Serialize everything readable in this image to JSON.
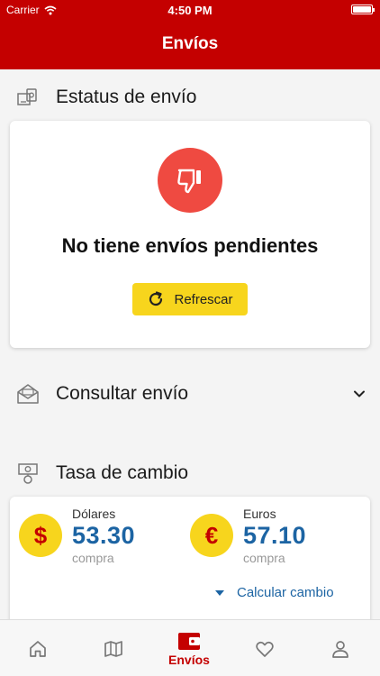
{
  "status_bar": {
    "carrier": "Carrier",
    "time": "4:50 PM"
  },
  "header": {
    "title": "Envíos"
  },
  "shipment_status": {
    "title": "Estatus de envío",
    "empty_message": "No tiene envíos pendientes",
    "refresh_label": "Refrescar"
  },
  "consult": {
    "title": "Consultar envío"
  },
  "exchange": {
    "title": "Tasa de cambio",
    "dollars": {
      "symbol": "$",
      "name": "Dólares",
      "value": "53.30",
      "sub": "compra"
    },
    "euros": {
      "symbol": "€",
      "name": "Euros",
      "value": "57.10",
      "sub": "compra"
    },
    "calc_label": "Calcular cambio"
  },
  "tabs": [
    {
      "id": "home",
      "icon": "home-icon",
      "label": ""
    },
    {
      "id": "map",
      "icon": "map-icon",
      "label": ""
    },
    {
      "id": "envios",
      "icon": "wallet-icon",
      "label": "Envíos",
      "active": true
    },
    {
      "id": "favorites",
      "icon": "heart-icon",
      "label": ""
    },
    {
      "id": "profile",
      "icon": "user-icon",
      "label": ""
    }
  ],
  "colors": {
    "brand_red": "#c40000",
    "accent_yellow": "#f7d51d",
    "value_blue": "#1c64a3",
    "alert_red": "#ef4a41"
  }
}
